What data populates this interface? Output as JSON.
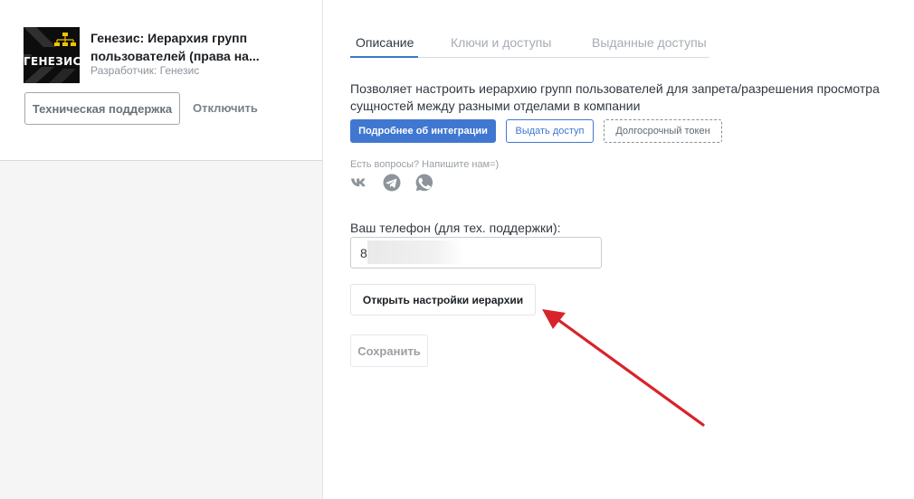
{
  "app": {
    "logo_text": "ГЕНЕЗИС",
    "title": "Генезис: Иерархия групп пользователей (права на...",
    "developer": "Разработчик: Генезис",
    "support_button": "Техническая поддержка",
    "disable_button": "Отключить"
  },
  "tabs": [
    {
      "label": "Описание",
      "active": true
    },
    {
      "label": "Ключи и доступы",
      "active": false
    },
    {
      "label": "Выданные доступы",
      "active": false
    }
  ],
  "description": "Позволяет настроить иерархию групп пользователей для запрета/разрешения просмотра сущностей между разными отделами в компании",
  "actions": {
    "more_info": "Подробнее об интеграции",
    "grant_access": "Выдать доступ",
    "long_token": "Долгосрочный токен"
  },
  "contact": {
    "questions": "Есть вопросы? Напишите нам=)",
    "icons": [
      "vk-icon",
      "telegram-icon",
      "whatsapp-icon"
    ]
  },
  "phone": {
    "label": "Ваш телефон (для тех. поддержки):",
    "value": "8"
  },
  "open_settings_button": "Открыть настройки иерархии",
  "save_button": "Сохранить",
  "colors": {
    "accent": "#4077d1",
    "annotation_arrow": "#d8232a"
  }
}
